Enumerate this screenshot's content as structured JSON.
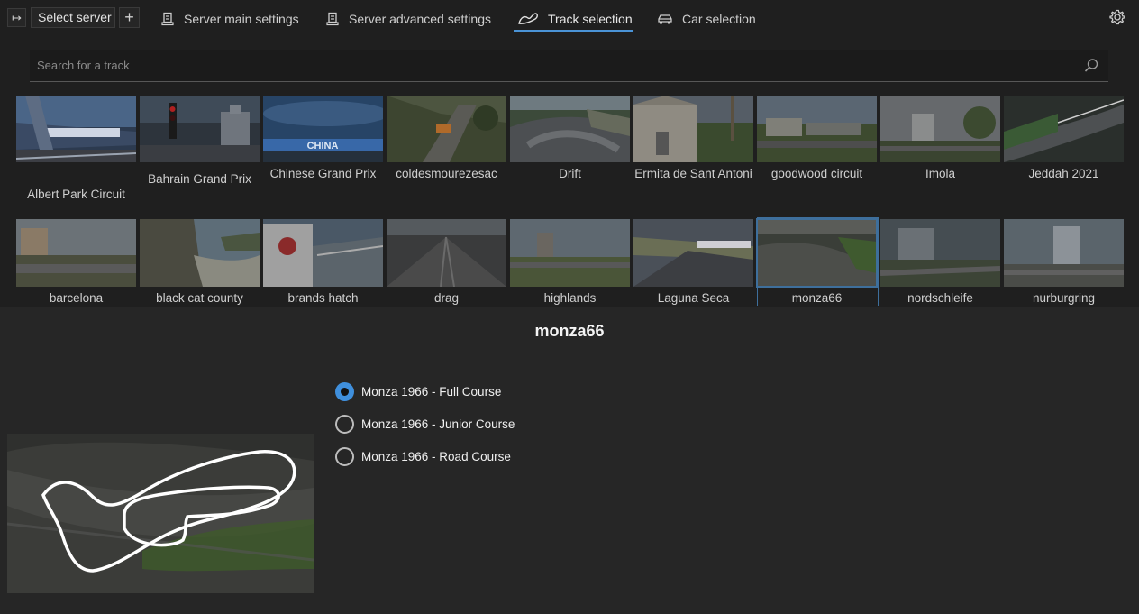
{
  "toolbar": {
    "pin_icon_glyph": "↦",
    "server_select_label": "Select server",
    "add_server_glyph": "+",
    "tabs": [
      {
        "label": "Server main settings",
        "icon": "server-icon"
      },
      {
        "label": "Server advanced settings",
        "icon": "server-icon"
      },
      {
        "label": "Track selection",
        "icon": "track-icon"
      },
      {
        "label": "Car selection",
        "icon": "car-icon"
      }
    ],
    "active_tab": "Track selection",
    "settings_icon": "gear-icon"
  },
  "search": {
    "placeholder": "Search for a track",
    "value": ""
  },
  "tracks_row1": [
    {
      "name": "Albert Park Circuit"
    },
    {
      "name": "Bahrain Grand Prix"
    },
    {
      "name": "Chinese Grand Prix"
    },
    {
      "name": "coldesmourezesac"
    },
    {
      "name": "Drift"
    },
    {
      "name": "Ermita de Sant Antoni"
    },
    {
      "name": "goodwood circuit"
    },
    {
      "name": "Imola"
    },
    {
      "name": "Jeddah 2021"
    }
  ],
  "tracks_row2": [
    {
      "name": "barcelona"
    },
    {
      "name": "black cat county"
    },
    {
      "name": "brands hatch"
    },
    {
      "name": "drag"
    },
    {
      "name": "highlands"
    },
    {
      "name": "Laguna Seca"
    },
    {
      "name": "monza66"
    },
    {
      "name": "nordschleife"
    },
    {
      "name": "nurburgring"
    }
  ],
  "selected_track": {
    "title": "monza66",
    "layouts": [
      {
        "label": "Monza 1966 - Full Course",
        "selected": true
      },
      {
        "label": "Monza 1966 - Junior Course",
        "selected": false
      },
      {
        "label": "Monza 1966 - Road Course",
        "selected": false
      }
    ]
  },
  "colors": {
    "accent": "#3f8fdc",
    "background": "#1f1f1f",
    "panel": "#262626"
  }
}
